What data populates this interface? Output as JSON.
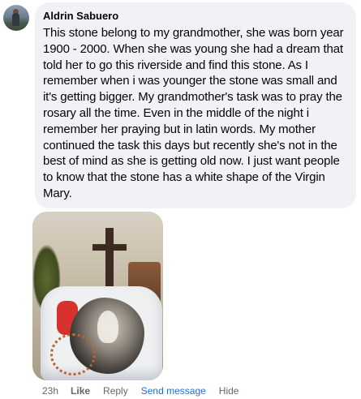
{
  "comment": {
    "author": "Aldrin Sabuero",
    "text": "This stone belong to my grandmother, she was born year 1900 - 2000. When she was young she had a dream that told her to go this riverside and find this stone. As I remember when i was younger the stone was small and it's getting bigger. My grandmother's task was to pray the rosary all the time. Even in the middle of the night i remember her praying but in latin words. My mother continued the task this days but recently she's not in the best of mind as she is getting old now. I just want people to know that the stone has a white shape of the Virgin Mary.",
    "image_alt": "Stone in a white bowl with rosary in front of a crucifix"
  },
  "actions": {
    "time": "23h",
    "like": "Like",
    "reply": "Reply",
    "send_message": "Send message",
    "hide": "Hide"
  },
  "colors": {
    "bubble_bg": "#f0f2f5",
    "text": "#050505",
    "meta_text": "#65676b",
    "link_blue": "#216fdb"
  }
}
